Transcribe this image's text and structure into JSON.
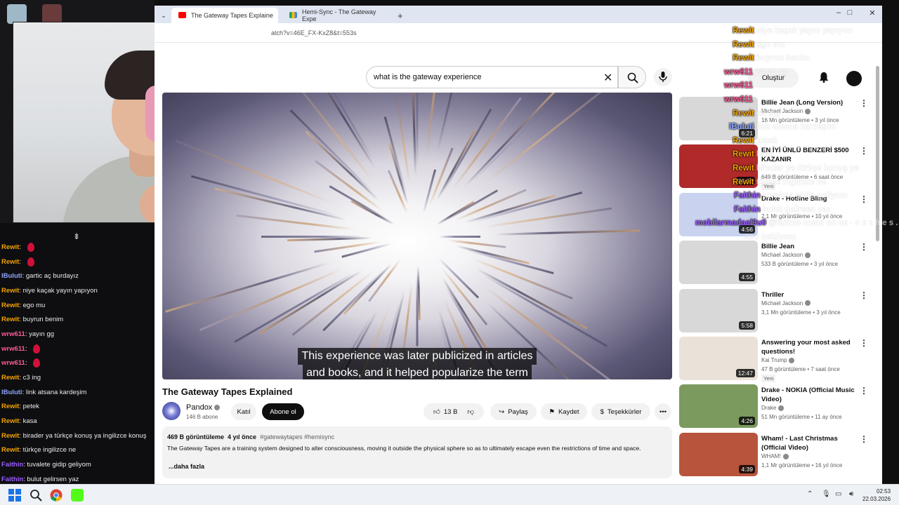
{
  "browser": {
    "tabs": [
      {
        "label": "The Gateway Tapes Explaine"
      },
      {
        "label": "Hemi-Sync - The Gateway Expe"
      }
    ],
    "new_tab": "+",
    "url": "atch?v=46E_FX-KxZ8&t=553s",
    "window_controls": {
      "minimize": "–",
      "maximize": "□",
      "close": "✕"
    }
  },
  "youtube": {
    "search": {
      "value": "what is the gateway experience",
      "clear": "✕"
    },
    "create_label": "Oluştur",
    "player": {
      "subtitle_line1": "This experience was later publicized in articles",
      "subtitle_line2": "and books, and it helped popularize the term"
    },
    "video": {
      "title": "The Gateway Tapes Explained",
      "channel": "Pandox",
      "subscribers": "146 B abone",
      "join_label": "Katıl",
      "subscribe_label": "Abone ol",
      "likes": "13 B",
      "share_label": "Paylaş",
      "save_label": "Kaydet",
      "thanks_label": "Teşekkürler",
      "more_label": "•••"
    },
    "description": {
      "views": "469 B görüntüleme",
      "age": "4 yıl önce",
      "tags": "#gatewaytapes #hemisync",
      "text": "The Gateway Tapes are a training system designed to alter consciousness, moving it outside the physical sphere so as to ultimately escape even the restrictions of time and space.",
      "more": "...daha fazla"
    },
    "recommendations": [
      {
        "title": "Billie Jean (Long Version)",
        "channel": "Michael Jackson",
        "stats": "16 Mn görüntüleme • 3 yıl önce",
        "duration": "6:21",
        "badge": ""
      },
      {
        "title": "EN İYİ ÜNLÜ BENZERİ $500 KAZANIR",
        "channel": "",
        "stats": "649 B görüntüleme • 6 saat önce",
        "duration": "36:05",
        "badge": "Yeni"
      },
      {
        "title": "Drake - Hotline Bling",
        "channel": "",
        "stats": "2,1 Mr görüntüleme • 10 yıl önce",
        "duration": "4:56",
        "badge": ""
      },
      {
        "title": "Billie Jean",
        "channel": "Michael Jackson",
        "stats": "533 B görüntüleme • 3 yıl önce",
        "duration": "4:55",
        "badge": ""
      },
      {
        "title": "Thriller",
        "channel": "Michael Jackson",
        "stats": "3,1 Mn görüntüleme • 3 yıl önce",
        "duration": "5:58",
        "badge": ""
      },
      {
        "title": "Answering your most asked questions!",
        "channel": "Kai Trump",
        "stats": "47 B görüntüleme • 7 saat önce",
        "duration": "12:47",
        "badge": "Yeni"
      },
      {
        "title": "Drake - NOKIA (Official Music Video)",
        "channel": "Drake",
        "stats": "51 Mn görüntüleme • 11 ay önce",
        "duration": "4:26",
        "badge": ""
      },
      {
        "title": "Wham! - Last Christmas (Official Video)",
        "channel": "WHAM!",
        "stats": "1,1 Mr görüntüleme • 16 yıl önce",
        "duration": "4:39",
        "badge": ""
      }
    ]
  },
  "chat_left": [
    {
      "user": "Rewit",
      "msg": "",
      "drop": true,
      "color": "#f4a300"
    },
    {
      "user": "Rewit",
      "msg": "",
      "drop": true,
      "color": "#f4a300"
    },
    {
      "user": "lBuluti",
      "msg": "gartic aç burdayız",
      "drop": false,
      "color": "#8ea5ff"
    },
    {
      "user": "Rewit",
      "msg": "niye kaçak yayın yapıyon",
      "drop": false,
      "color": "#f4a300"
    },
    {
      "user": "Rewit",
      "msg": "ego mu",
      "drop": false,
      "color": "#f4a300"
    },
    {
      "user": "Rewit",
      "msg": "buyrun benim",
      "drop": false,
      "color": "#f4a300"
    },
    {
      "user": "wrw611",
      "msg": "yayın gg",
      "drop": false,
      "color": "#ff5a9a"
    },
    {
      "user": "wrw611",
      "msg": "",
      "drop": true,
      "color": "#ff5a9a"
    },
    {
      "user": "wrw611",
      "msg": "",
      "drop": true,
      "color": "#ff5a9a"
    },
    {
      "user": "Rewit",
      "msg": "c3 ing",
      "drop": false,
      "color": "#f4a300"
    },
    {
      "user": "lBuluti",
      "msg": "link atsana kardeşim",
      "drop": false,
      "color": "#8ea5ff"
    },
    {
      "user": "Rewit",
      "msg": "petek",
      "drop": false,
      "color": "#f4a300"
    },
    {
      "user": "Rewit",
      "msg": "kasa",
      "drop": false,
      "color": "#f4a300"
    },
    {
      "user": "Rewit",
      "msg": "birader ya türkçe konuş ya ingilizce konuş",
      "drop": false,
      "color": "#f4a300"
    },
    {
      "user": "Rewit",
      "msg": "türkçe ingilizce ne",
      "drop": false,
      "color": "#f4a300"
    },
    {
      "user": "Faithin",
      "msg": "tuvalete gidip geliyom",
      "drop": false,
      "color": "#9b5cff"
    },
    {
      "user": "Faithin",
      "msg": "bulut gelirsen yaz",
      "drop": false,
      "color": "#9b5cff"
    }
  ],
  "overlay_chat": [
    {
      "user": "Rewit",
      "msg": "niye kaçak yayın yapıyon",
      "color": "#f4a300"
    },
    {
      "user": "Rewit",
      "msg": "ego mu",
      "color": "#f4a300"
    },
    {
      "user": "Rewit",
      "msg": "buyrun benim",
      "color": "#f4a300"
    },
    {
      "user": "wrw611",
      "msg": "yayın gg",
      "color": "#ff5a9a"
    },
    {
      "user": "wrw611",
      "msg": "",
      "color": "#ff5a9a"
    },
    {
      "user": "wrw611",
      "msg": "",
      "color": "#ff5a9a"
    },
    {
      "user": "Rewit",
      "msg": "c3 ing",
      "color": "#f4a300"
    },
    {
      "user": "lBuluti",
      "msg": "link atsana kardeşim",
      "color": "#8ea5ff"
    },
    {
      "user": "Rewit",
      "msg": "petek",
      "color": "#f4a300"
    },
    {
      "user": "Rewit",
      "msg": "kasa",
      "color": "#f4a300"
    },
    {
      "user": "Rewit",
      "msg": "birader ya türkçe konuş ya",
      "color": "#f4a300"
    },
    {
      "user": "Rewit",
      "msg": "türkçe ingilizce ne",
      "color": "#f4a300"
    },
    {
      "user": "Faithin",
      "msg": "tuvalete gidip geliyom",
      "color": "#9b5cff"
    },
    {
      "user": "Faithin",
      "msg": "bulut gelirsen yaz",
      "color": "#9b5cff"
    },
    {
      "user": "mobilarmadaal9u0",
      "msg": "@faithin come on us - n e z h e s . c",
      "color": "#9b5cff"
    },
    {
      "user": "",
      "msg": "aoo bekliyom",
      "color": "#9b5cff"
    }
  ],
  "taskbar": {
    "time": "02:53",
    "date": "22.03.2026",
    "tray_up": "⌃"
  },
  "colors": {
    "youtube_red": "#ff0000",
    "accent_subscribe": "#0f0f0f"
  },
  "icons": [
    "recycle-bin-icon",
    "windows-start-icon",
    "search-icon",
    "chrome-icon",
    "kick-icon",
    "mic-icon",
    "bell-icon",
    "like-icon",
    "dislike-icon",
    "share-icon",
    "save-icon",
    "thanks-icon",
    "more-vert-icon",
    "clear-icon"
  ]
}
